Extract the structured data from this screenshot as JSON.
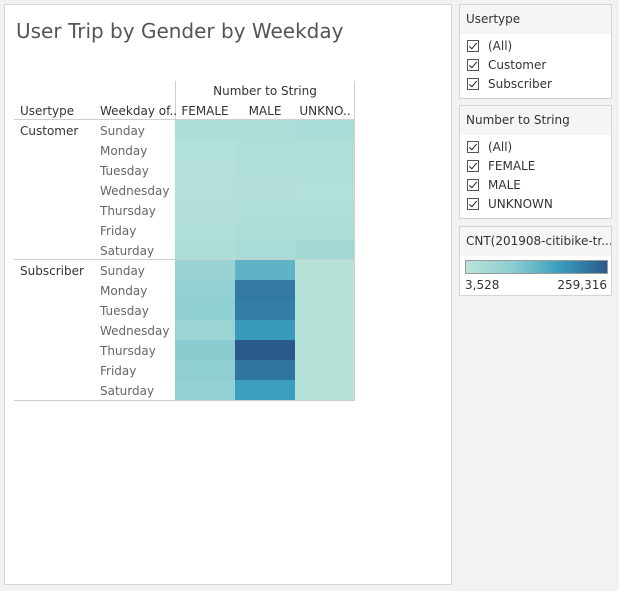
{
  "title": "User Trip by Gender by Weekday",
  "column_header": "Number to String",
  "row_header_1": "Usertype",
  "row_header_2": "Weekday of..",
  "chart_data": {
    "type": "heatmap",
    "title": "User Trip by Gender by Weekday",
    "columns": [
      "FEMALE",
      "MALE",
      "UNKNO.."
    ],
    "groups": [
      {
        "name": "Customer",
        "rows": [
          "Sunday",
          "Monday",
          "Tuesday",
          "Wednesday",
          "Thursday",
          "Friday",
          "Saturday"
        ],
        "values": [
          [
            26000,
            24000,
            34000
          ],
          [
            16000,
            21000,
            20000
          ],
          [
            15000,
            21000,
            18000
          ],
          [
            14000,
            17000,
            16000
          ],
          [
            17000,
            21000,
            22000
          ],
          [
            18000,
            24000,
            24000
          ],
          [
            28000,
            34000,
            45000
          ]
        ]
      },
      {
        "name": "Subscriber",
        "rows": [
          "Sunday",
          "Monday",
          "Tuesday",
          "Wednesday",
          "Thursday",
          "Friday",
          "Saturday"
        ],
        "values": [
          [
            65000,
            135000,
            9000
          ],
          [
            76000,
            218000,
            9000
          ],
          [
            79000,
            213000,
            9000
          ],
          [
            63000,
            178000,
            9000
          ],
          [
            91000,
            259316,
            9000
          ],
          [
            83000,
            225000,
            9000
          ],
          [
            75000,
            173000,
            9000
          ]
        ]
      }
    ],
    "color_scale": {
      "min": 3528,
      "max": 259316,
      "min_label": "3,528",
      "max_label": "259,316",
      "stops": [
        "#b9e4da",
        "#8ccdd0",
        "#3a9dbe",
        "#2a5a8a"
      ]
    }
  },
  "filters": [
    {
      "title": "Usertype",
      "options": [
        "(All)",
        "Customer",
        "Subscriber"
      ]
    },
    {
      "title": "Number to String",
      "options": [
        "(All)",
        "FEMALE",
        "MALE",
        "UNKNOWN"
      ]
    }
  ],
  "legend": {
    "title": "CNT(201908-citibike-tr..."
  }
}
